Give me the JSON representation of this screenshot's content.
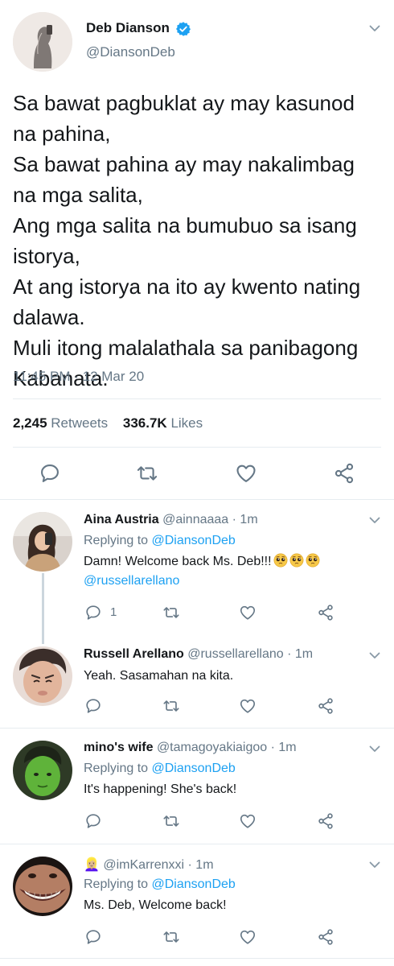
{
  "main_tweet": {
    "name": "Deb Dianson",
    "handle": "@DiansonDeb",
    "text_lines": [
      "Sa bawat pagbuklat ay may kasunod",
      "na pahina,",
      "Sa bawat pahina ay may nakalimbag",
      "na mga salita,",
      "Ang mga salita na bumubuo sa isang",
      "istorya,",
      "At ang istorya na ito ay kwento nating",
      "dalawa.",
      "Muli itong malalathala sa panibagong",
      "Kabanata."
    ],
    "timestamp": "11:45 PM · 12 Mar 20",
    "retweets_count": "2,245",
    "retweets_label": "Retweets",
    "likes_count": "336.7K",
    "likes_label": "Likes"
  },
  "replies": [
    {
      "name": "Aina Austria",
      "handle": "@ainnaaaa · 1m",
      "replying_prefix": "Replying to",
      "replying_to": "@DiansonDeb",
      "text": "Damn! Welcome back Ms. Deb!!!",
      "mention": "@russellarellano",
      "reply_count": "1"
    },
    {
      "name": "Russell Arellano",
      "handle": "@russellarellano · 1m",
      "text": "Yeah. Sasamahan na kita."
    },
    {
      "name": "mino's wife",
      "handle": "@tamagoyakiaigoo · 1m",
      "replying_prefix": "Replying to",
      "replying_to": "@DiansonDeb",
      "text": "It's happening! She's back!"
    },
    {
      "name": "👱🏼‍♀️",
      "handle": "@imKarrenxxi · 1m",
      "replying_prefix": "Replying to",
      "replying_to": "@DiansonDeb",
      "text": "Ms. Deb, Welcome back!"
    }
  ],
  "colors": {
    "accent": "#1da1f2",
    "secondary_text": "#657786",
    "icon": "#657786",
    "divider": "#e6ecf0",
    "thread_line": "#ccd6dd"
  }
}
